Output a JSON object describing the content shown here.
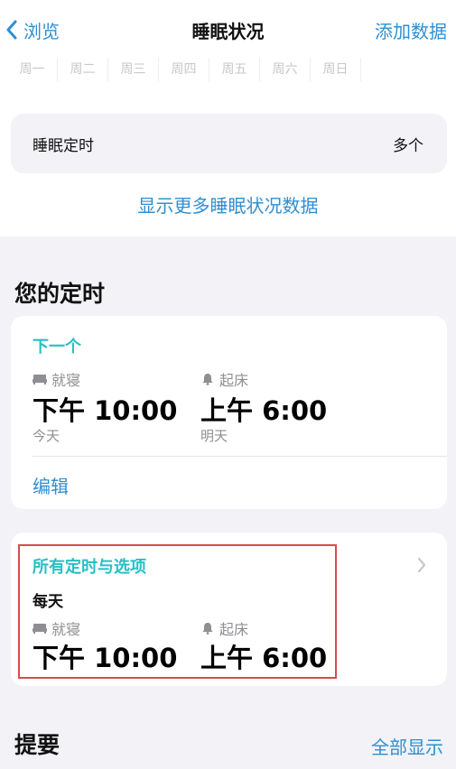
{
  "nav": {
    "back_label": "浏览",
    "title": "睡眠状况",
    "action_label": "添加数据"
  },
  "weekdays": [
    "周一",
    "周二",
    "周三",
    "周四",
    "周五",
    "周六",
    "周日"
  ],
  "sleep_schedule_row": {
    "label": "睡眠定时",
    "value": "多个"
  },
  "show_more_label": "显示更多睡眠状况数据",
  "your_schedule": {
    "title": "您的定时",
    "next_card": {
      "heading": "下一个",
      "bedtime_label": "就寝",
      "bedtime": "下午 10:00",
      "bedtime_day": "今天",
      "wake_label": "起床",
      "wake": "上午 6:00",
      "wake_day": "明天",
      "edit_label": "编辑"
    },
    "all_card": {
      "heading": "所有定时与选项",
      "frequency": "每天",
      "bedtime_label": "就寝",
      "bedtime": "下午 10:00",
      "wake_label": "起床",
      "wake": "上午 6:00"
    }
  },
  "summary": {
    "title": "提要",
    "show_all_label": "全部显示"
  },
  "colors": {
    "accent_blue": "#2f8fd1",
    "teal": "#28bfc4",
    "highlight_red": "#d94a4a",
    "background": "#f2f2f7"
  },
  "icons": {
    "back": "chevron-left-icon",
    "bed": "bed-icon",
    "alarm": "bell-icon",
    "disclosure": "chevron-right-icon"
  }
}
